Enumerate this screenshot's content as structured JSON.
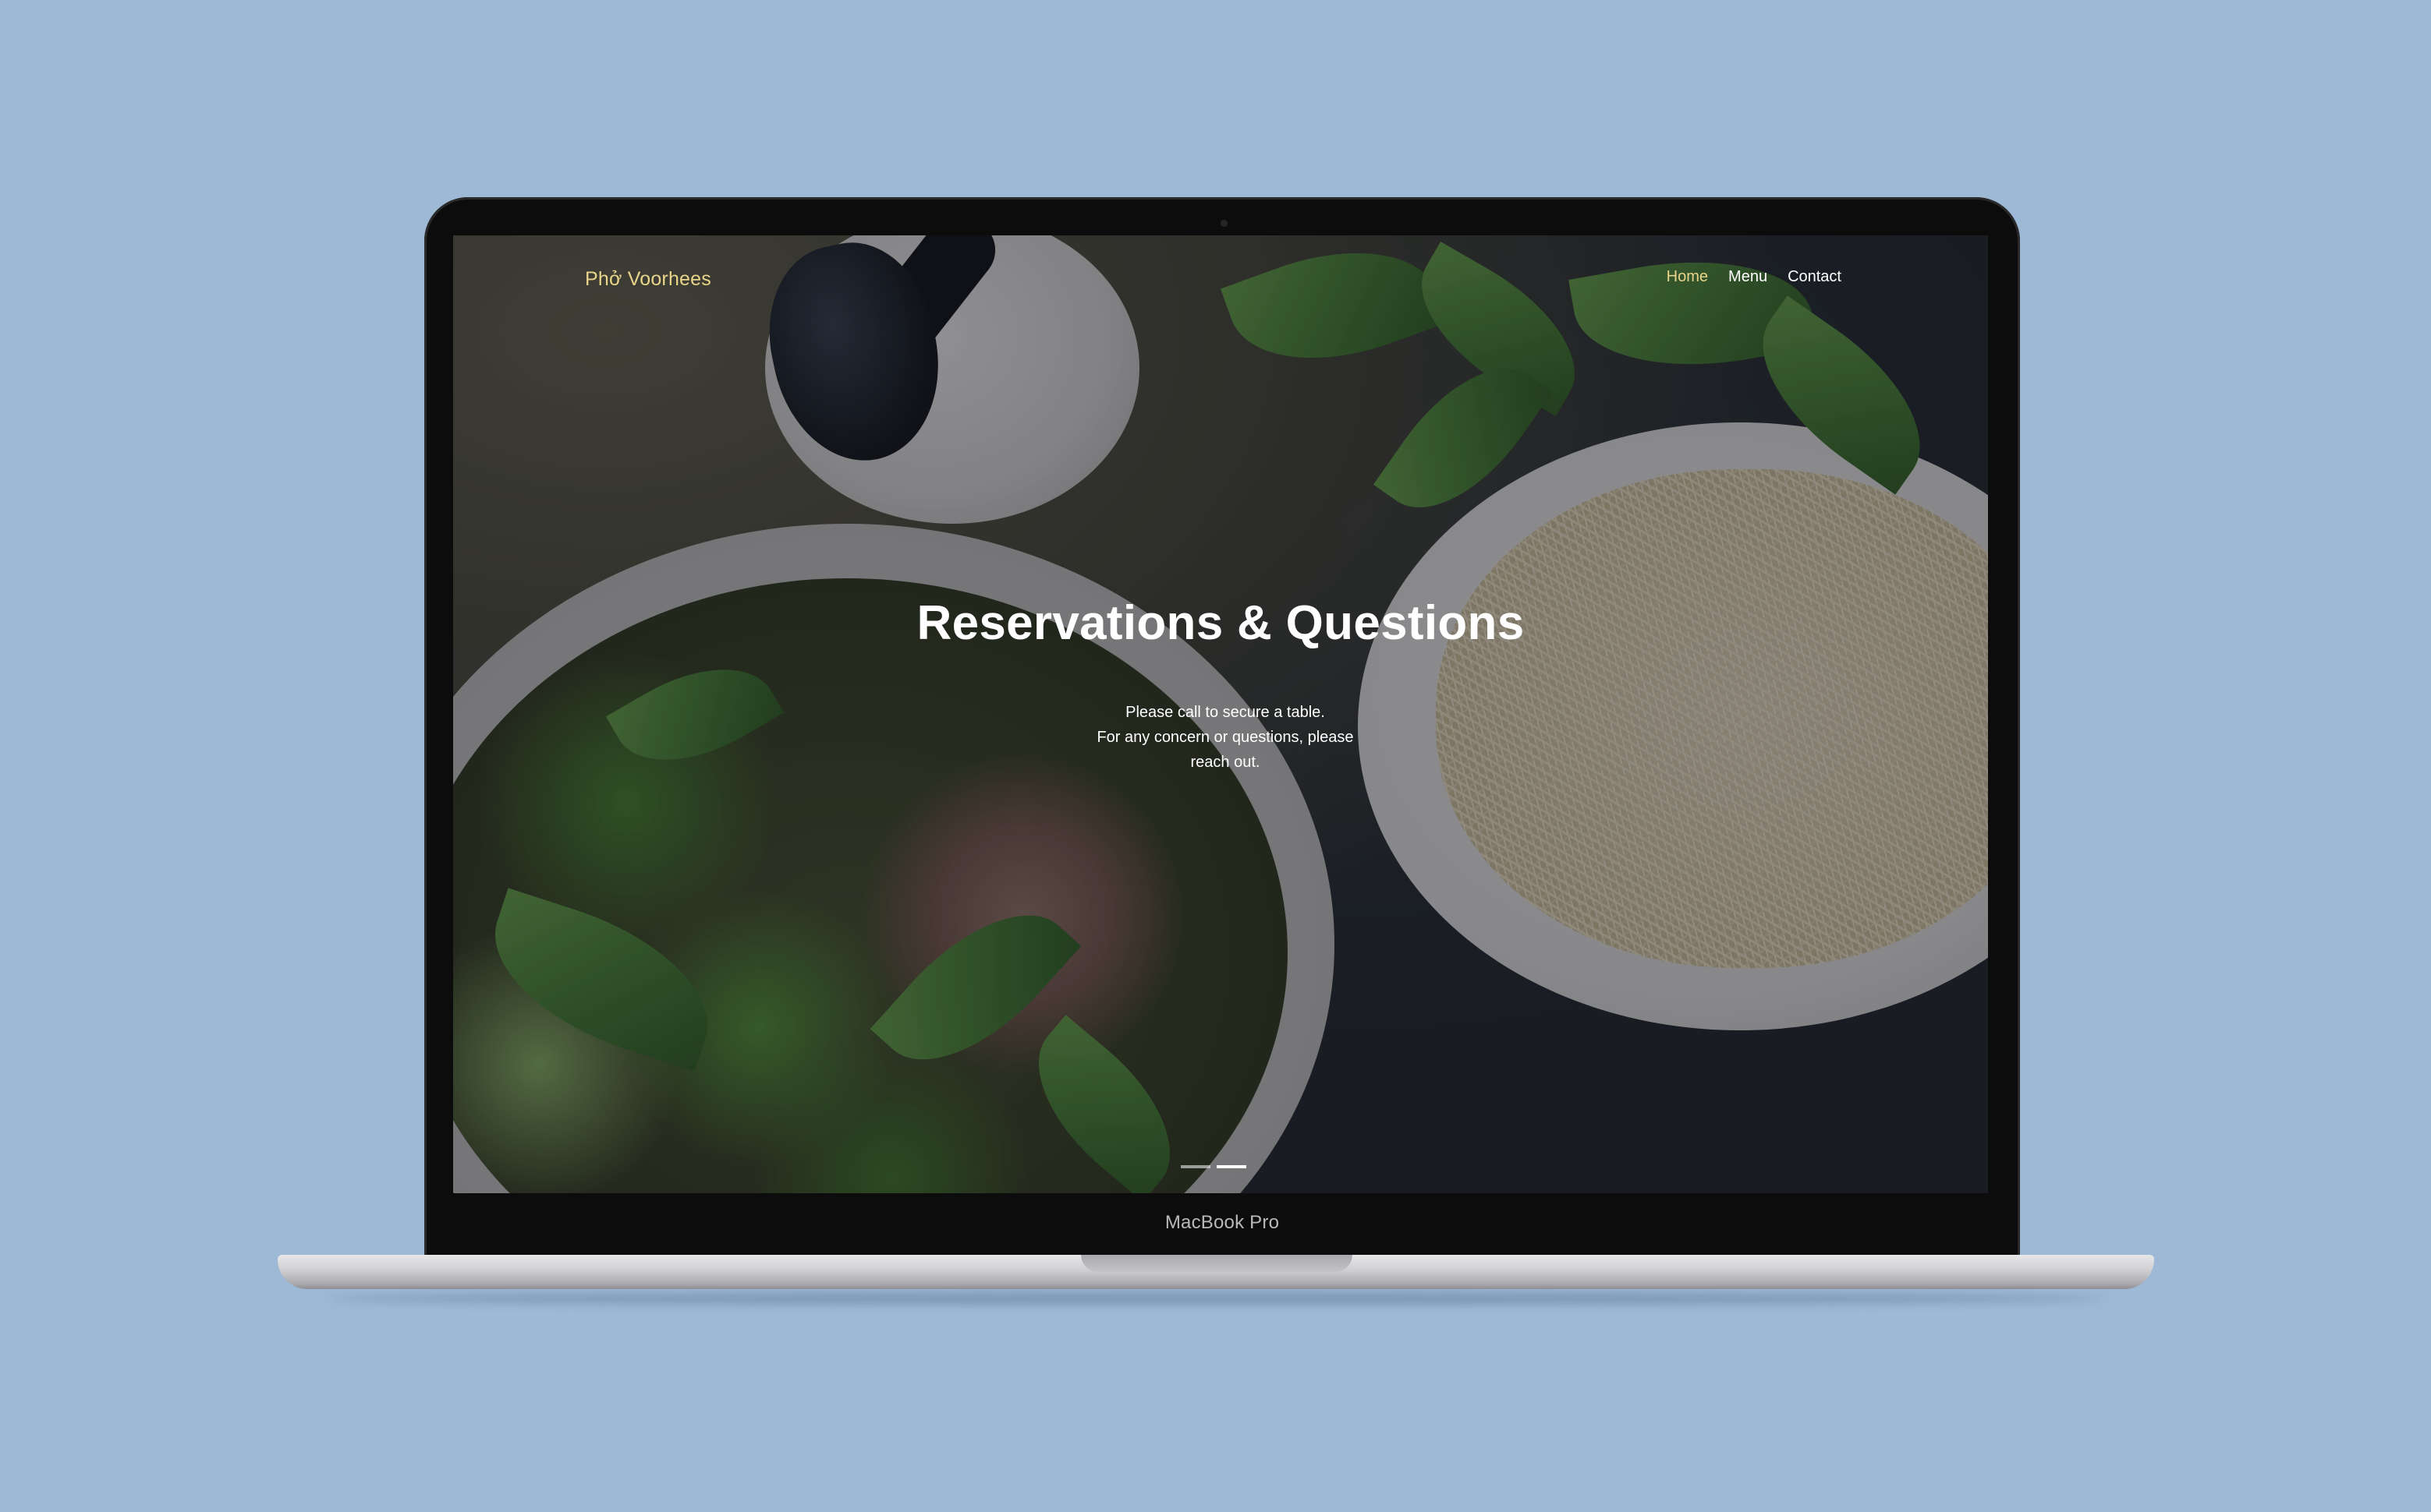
{
  "site": {
    "brand": "Phở Voorhees",
    "nav": {
      "home": "Home",
      "menu": "Menu",
      "contact": "Contact"
    },
    "active_nav": "home"
  },
  "hero": {
    "title": "Reservations & Questions",
    "lines": [
      "Please call to secure a table.",
      "For any concern or questions, please",
      "reach out."
    ],
    "slides_total": 2,
    "active_slide": 2
  },
  "device": {
    "label": "MacBook Pro"
  },
  "colors": {
    "page_background": "#9eb9d6",
    "brand_gold": "#e8d48a",
    "text_white": "#ffffff"
  }
}
